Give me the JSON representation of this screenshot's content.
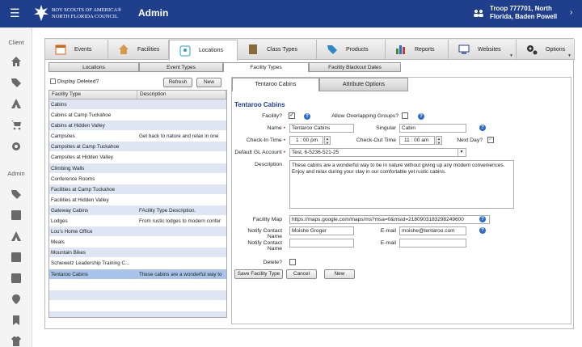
{
  "header": {
    "org_line1": "BOY SCOUTS OF AMERICA®",
    "org_line2": "NORTH FLORIDA COUNCIL",
    "app_title": "Admin",
    "troop_line1": "Troop 777701, North",
    "troop_line2": "Florida, Baden Powell",
    "bg_color": "#1f3f8c"
  },
  "sidebar": {
    "client_label": "Client",
    "admin_label": "Admin"
  },
  "top_tabs": [
    {
      "label": "Events"
    },
    {
      "label": "Facilities"
    },
    {
      "label": "Locations"
    },
    {
      "label": "Class Types"
    },
    {
      "label": "Products"
    },
    {
      "label": "Reports"
    },
    {
      "label": "Websites"
    },
    {
      "label": "Options"
    }
  ],
  "sub_tabs": [
    {
      "label": "Locations"
    },
    {
      "label": "Event Types"
    },
    {
      "label": "Facility Types"
    },
    {
      "label": "Facility Blackout Dates"
    }
  ],
  "list": {
    "display_deleted_label": "Display Deleted?",
    "refresh_label": "Refresh",
    "new_label": "New",
    "col_type": "Facility Type",
    "col_desc": "Description",
    "rows": [
      {
        "type": "Cabins",
        "desc": ""
      },
      {
        "type": "Cabins at Camp Tuckahoe",
        "desc": ""
      },
      {
        "type": "Cabins at Hidden Valley",
        "desc": ""
      },
      {
        "type": "Campsites",
        "desc": "Get back to nature and relax in one"
      },
      {
        "type": "Campsites at Camp Tuckahoe",
        "desc": ""
      },
      {
        "type": "Campsites at Hidden Valley",
        "desc": ""
      },
      {
        "type": "Climbing Walls",
        "desc": ""
      },
      {
        "type": "Conference Rooms",
        "desc": ""
      },
      {
        "type": "Facilities at Camp Tuckahoe",
        "desc": ""
      },
      {
        "type": "Facilities at Hidden Valley",
        "desc": ""
      },
      {
        "type": "Gateway Cabins",
        "desc": "FAcility Type Description."
      },
      {
        "type": "Lodges",
        "desc": "From rustic lodges to modern confer"
      },
      {
        "type": "Lou's Home Office",
        "desc": ""
      },
      {
        "type": "Meals",
        "desc": ""
      },
      {
        "type": "Mountain Bikes",
        "desc": ""
      },
      {
        "type": "Schiewetz Leadership Training C...",
        "desc": ""
      },
      {
        "type": "Tentaroo Cabins",
        "desc": "These cabins are a wonderful way to"
      },
      {
        "type": "",
        "desc": ""
      },
      {
        "type": "",
        "desc": ""
      },
      {
        "type": "",
        "desc": ""
      },
      {
        "type": "",
        "desc": ""
      }
    ]
  },
  "detail": {
    "tab_main": "Tentaroo Cabins",
    "tab_attr": "Attribute Options",
    "title": "Tentaroo Cabins",
    "facility_label": "Facility?",
    "overlap_label": "Allow Overlapping Groups?",
    "name_label": "Name",
    "name_value": "Tentaroo Cabins",
    "singular_label": "Singular",
    "singular_value": "Cabin",
    "checkin_label": "Check-In Time",
    "checkin_h": "1",
    "checkin_m": "00",
    "checkin_ampm": "pm",
    "checkout_label": "Check-Out Time",
    "checkout_h": "11",
    "checkout_m": "00",
    "checkout_ampm": "am",
    "nextday_label": "Next Day?",
    "gl_label": "Default GL Account",
    "gl_value": "Test, 6-5236-521-25",
    "desc_label": "Description",
    "desc_value": "These cabins are a wonderful way to be in nature without giving up any modern conveniences. Enjoy and relax during your stay in our comfortable yet rustic cabins.",
    "map_label": "Facility Map",
    "map_value": "https://maps.google.com/maps/ms?msa=0&msid=2180903183298249600",
    "contact_label": "Notify Contact Name",
    "contact1_value": "Moishe Groger",
    "email_label": "E-mail",
    "email1_value": "moishe@tentaroo.com",
    "contact2_value": "",
    "email2_value": "",
    "delete_label": "Delete?",
    "save_label": "Save Facility Type",
    "cancel_label": "Cancel",
    "new_label": "New"
  }
}
